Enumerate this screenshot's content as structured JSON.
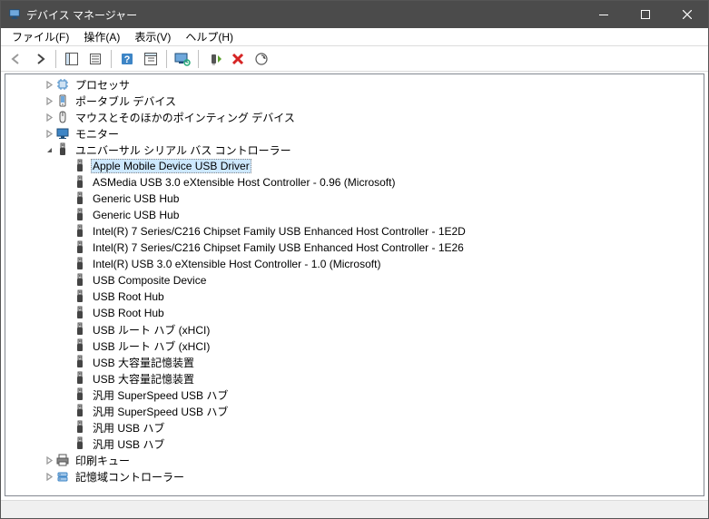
{
  "window": {
    "title": "デバイス マネージャー"
  },
  "menu": {
    "file": "ファイル(F)",
    "action": "操作(A)",
    "view": "表示(V)",
    "help": "ヘルプ(H)"
  },
  "toolbar_icons": {
    "back": "back-arrow",
    "forward": "forward-arrow",
    "show_hide_tree": "tree-pane",
    "properties": "properties",
    "help": "help",
    "show_hidden": "show-hidden",
    "computer_scan": "scan-monitor",
    "update_driver": "update-driver",
    "uninstall": "uninstall-x",
    "scan_hardware": "scan-hardware"
  },
  "tree": {
    "nodes": [
      {
        "indent": 1,
        "expander": "collapsed",
        "icon": "cpu",
        "label": "プロセッサ",
        "selected": false
      },
      {
        "indent": 1,
        "expander": "collapsed",
        "icon": "portable",
        "label": "ポータブル デバイス",
        "selected": false
      },
      {
        "indent": 1,
        "expander": "collapsed",
        "icon": "mouse",
        "label": "マウスとそのほかのポインティング デバイス",
        "selected": false
      },
      {
        "indent": 1,
        "expander": "collapsed",
        "icon": "monitor",
        "label": "モニター",
        "selected": false
      },
      {
        "indent": 1,
        "expander": "expanded",
        "icon": "usb",
        "label": "ユニバーサル シリアル バス コントローラー",
        "selected": false
      },
      {
        "indent": 2,
        "expander": "none",
        "icon": "usb",
        "label": "Apple Mobile Device USB Driver",
        "selected": true
      },
      {
        "indent": 2,
        "expander": "none",
        "icon": "usb",
        "label": "ASMedia USB 3.0 eXtensible Host Controller - 0.96 (Microsoft)",
        "selected": false
      },
      {
        "indent": 2,
        "expander": "none",
        "icon": "usb",
        "label": "Generic USB Hub",
        "selected": false
      },
      {
        "indent": 2,
        "expander": "none",
        "icon": "usb",
        "label": "Generic USB Hub",
        "selected": false
      },
      {
        "indent": 2,
        "expander": "none",
        "icon": "usb",
        "label": "Intel(R) 7 Series/C216 Chipset Family USB Enhanced Host Controller - 1E2D",
        "selected": false
      },
      {
        "indent": 2,
        "expander": "none",
        "icon": "usb",
        "label": "Intel(R) 7 Series/C216 Chipset Family USB Enhanced Host Controller - 1E26",
        "selected": false
      },
      {
        "indent": 2,
        "expander": "none",
        "icon": "usb",
        "label": "Intel(R) USB 3.0 eXtensible Host Controller - 1.0 (Microsoft)",
        "selected": false
      },
      {
        "indent": 2,
        "expander": "none",
        "icon": "usb",
        "label": "USB Composite Device",
        "selected": false
      },
      {
        "indent": 2,
        "expander": "none",
        "icon": "usb",
        "label": "USB Root Hub",
        "selected": false
      },
      {
        "indent": 2,
        "expander": "none",
        "icon": "usb",
        "label": "USB Root Hub",
        "selected": false
      },
      {
        "indent": 2,
        "expander": "none",
        "icon": "usb",
        "label": "USB ルート ハブ (xHCI)",
        "selected": false
      },
      {
        "indent": 2,
        "expander": "none",
        "icon": "usb",
        "label": "USB ルート ハブ (xHCI)",
        "selected": false
      },
      {
        "indent": 2,
        "expander": "none",
        "icon": "usb",
        "label": "USB 大容量記憶装置",
        "selected": false
      },
      {
        "indent": 2,
        "expander": "none",
        "icon": "usb",
        "label": "USB 大容量記憶装置",
        "selected": false
      },
      {
        "indent": 2,
        "expander": "none",
        "icon": "usb",
        "label": "汎用 SuperSpeed USB ハブ",
        "selected": false
      },
      {
        "indent": 2,
        "expander": "none",
        "icon": "usb",
        "label": "汎用 SuperSpeed USB ハブ",
        "selected": false
      },
      {
        "indent": 2,
        "expander": "none",
        "icon": "usb",
        "label": "汎用 USB ハブ",
        "selected": false
      },
      {
        "indent": 2,
        "expander": "none",
        "icon": "usb",
        "label": "汎用 USB ハブ",
        "selected": false
      },
      {
        "indent": 1,
        "expander": "collapsed",
        "icon": "printer",
        "label": "印刷キュー",
        "selected": false
      },
      {
        "indent": 1,
        "expander": "collapsed",
        "icon": "storage",
        "label": "記憶域コントローラー",
        "selected": false
      }
    ]
  }
}
